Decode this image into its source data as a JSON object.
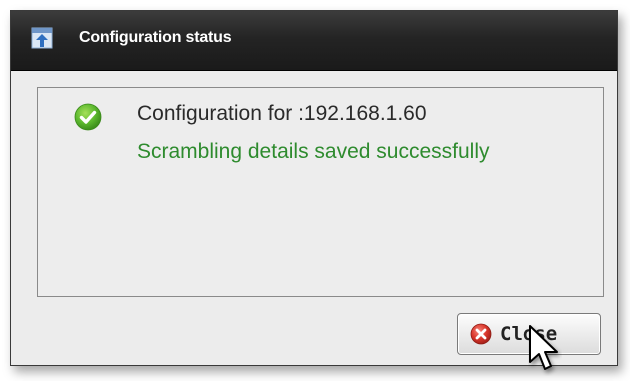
{
  "window": {
    "title": "Configuration status",
    "title_icon": "config-upload-icon"
  },
  "message": {
    "status_icon": "check-circle-icon",
    "line1": "Configuration for :192.168.1.60",
    "line2": "Scrambling details saved successfully",
    "line2_color": "#2e8b2e"
  },
  "actions": {
    "close_label": "Close",
    "close_icon": "close-circle-icon",
    "close_icon_color": "#d9362b"
  },
  "colors": {
    "titlebar": "#1f1f1f",
    "dialog_bg": "#ececec",
    "success_green": "#5cb82e"
  }
}
